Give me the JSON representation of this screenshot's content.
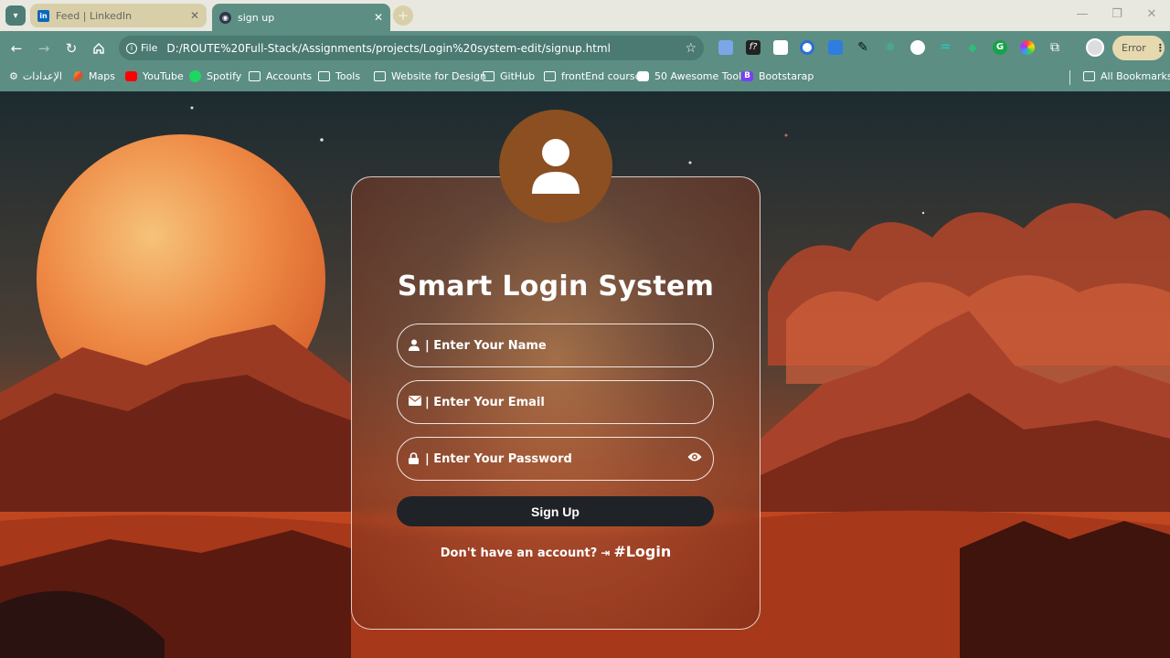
{
  "browser": {
    "tabs": [
      {
        "title": "Feed | LinkedIn",
        "favicon": "linkedin-icon",
        "active": false
      },
      {
        "title": "sign up",
        "favicon": "page-icon",
        "active": true
      }
    ],
    "address": {
      "chip_label": "File",
      "url": "D:/ROUTE%20Full-Stack/Assignments/projects/Login%20system-edit/signup.html"
    },
    "error_pill": "Error",
    "bookmarks": [
      {
        "label": "الإعدادات",
        "icon": "gear-icon"
      },
      {
        "label": "Maps",
        "icon": "maps-icon"
      },
      {
        "label": "YouTube",
        "icon": "youtube-icon"
      },
      {
        "label": "Spotify",
        "icon": "spotify-icon"
      },
      {
        "label": "Accounts",
        "icon": "folder-icon"
      },
      {
        "label": "Tools",
        "icon": "folder-icon"
      },
      {
        "label": "Website for Design",
        "icon": "folder-icon"
      },
      {
        "label": "GitHub",
        "icon": "folder-icon"
      },
      {
        "label": "frontEnd course",
        "icon": "folder-icon"
      },
      {
        "label": "50 Awesome Tools",
        "icon": "code-icon"
      },
      {
        "label": "Bootstarap",
        "icon": "bootstrap-icon"
      }
    ],
    "all_bookmarks": "All Bookmarks"
  },
  "page": {
    "title": "Smart Login System",
    "fields": {
      "name": {
        "placeholder": "| Enter Your Name",
        "icon": "user-icon"
      },
      "email": {
        "placeholder": "| Enter Your Email",
        "icon": "envelope-icon"
      },
      "password": {
        "placeholder": "| Enter Your Password",
        "icon": "lock-icon",
        "toggle_icon": "eye-icon"
      }
    },
    "submit_label": "Sign Up",
    "footer": {
      "question": "Don't have an account?",
      "link_label": "#Login"
    }
  },
  "colors": {
    "chrome": "#5c8e84",
    "avatar_bg": "#8b4f22",
    "button_bg": "#1f2327"
  }
}
